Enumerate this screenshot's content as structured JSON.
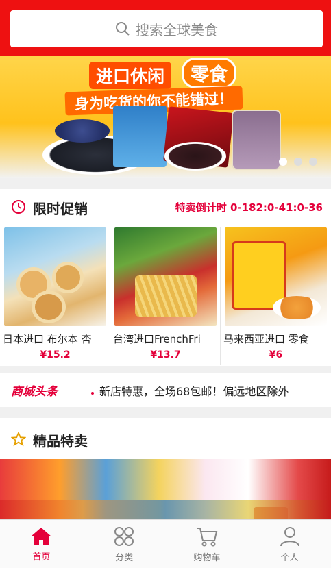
{
  "search": {
    "placeholder": "搜索全球美食"
  },
  "banner": {
    "title_main": "进口休闲",
    "title_badge": "零食",
    "subtitle": "身为吃货的你不能错过！",
    "dots": 3,
    "active_dot": 0
  },
  "flash_sale": {
    "title": "限时促销",
    "countdown_label": "特卖倒计时",
    "countdown_value": "0-182:0-41:0-36",
    "products": [
      {
        "name": "日本进口 布尔本 杏",
        "price": "¥15.2"
      },
      {
        "name": "台湾进口FrenchFri",
        "price": "¥13.7"
      },
      {
        "name": "马来西亚进口 零食",
        "price": "¥6"
      }
    ]
  },
  "news": {
    "logo": "商城头条",
    "text": "新店特惠，全场68包邮！偏远地区除外"
  },
  "featured": {
    "title": "精品特卖"
  },
  "tabbar": {
    "tabs": [
      {
        "label": "首页",
        "active": true
      },
      {
        "label": "分类",
        "active": false
      },
      {
        "label": "购物车",
        "active": false
      },
      {
        "label": "个人",
        "active": false
      }
    ]
  },
  "colors": {
    "brand": "#ee1111",
    "accent": "#e4003a"
  }
}
